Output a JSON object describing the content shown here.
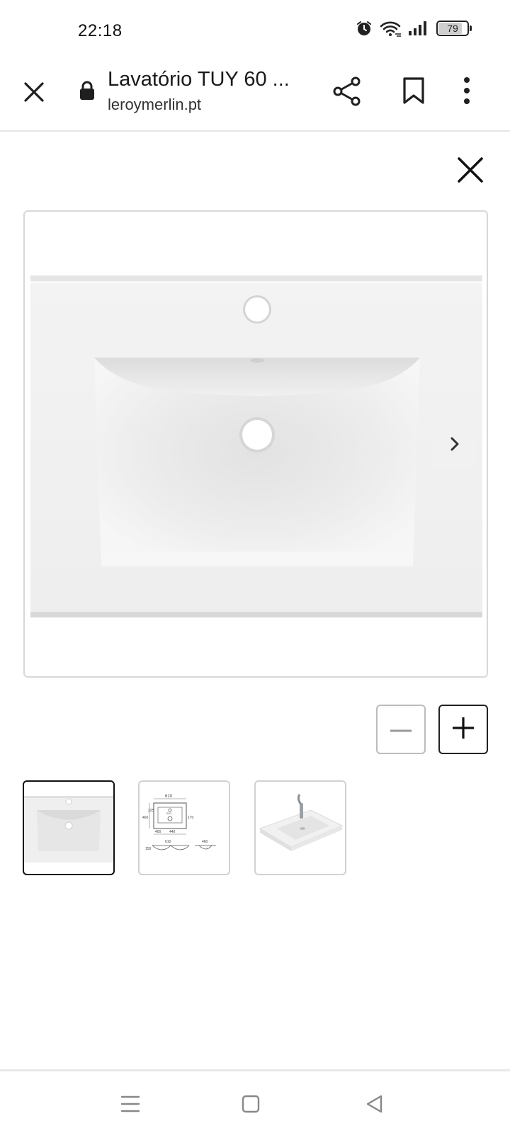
{
  "status_bar": {
    "time": "22:18",
    "battery_level": "79",
    "icons": [
      "alarm-icon",
      "wifi-icon",
      "signal-icon",
      "battery-icon"
    ]
  },
  "browser": {
    "page_title": "Lavatório TUY 60 ...",
    "url": "leroymerlin.pt",
    "icons": [
      "close-icon",
      "lock-icon",
      "share-icon",
      "bookmark-icon",
      "more-vert-icon"
    ]
  },
  "viewer": {
    "icons": [
      "close-icon",
      "chevron-right-icon",
      "minus-icon",
      "plus-icon"
    ],
    "thumbnails": [
      {
        "name": "thumbnail-sink-top-view",
        "selected": true
      },
      {
        "name": "thumbnail-technical-drawing",
        "selected": false,
        "labels": [
          "610",
          "225",
          "460",
          "220",
          "170",
          "400",
          "440",
          "460",
          "150"
        ]
      },
      {
        "name": "thumbnail-sink-with-faucet",
        "selected": false
      }
    ]
  },
  "nav_bar": {
    "icons": [
      "menu-icon",
      "home-icon",
      "back-icon"
    ]
  },
  "colors": {
    "accent_dark": "#1f1f1f",
    "border_light": "#d8d8d8",
    "sink_white": "#f4f4f4"
  }
}
